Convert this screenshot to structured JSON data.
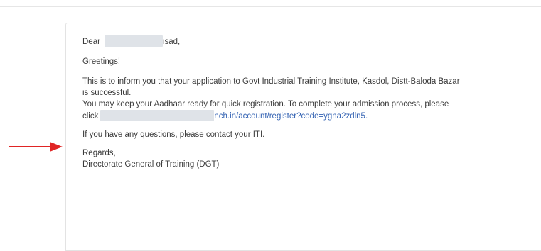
{
  "email": {
    "greeting_prefix": "Dear",
    "greeting_suffix": "isad,",
    "salutation": "Greetings!",
    "para1_line1": "This is to inform you that your application to Govt Industrial Training Institute, Kasdol, Distt-Baloda Bazar",
    "para1_line2": "is successful.",
    "para2_line1": "You may keep your Aadhaar ready for quick registration. To complete your admission process, please",
    "para2_prefix": "click",
    "link_visible": "nch.in/account/register?code=ygna2zdln5",
    "link_end": ".",
    "questions": "If you have any questions, please contact your ITI.",
    "closing": "Regards,",
    "signature": "Directorate General of Training (DGT)"
  },
  "annotation": {
    "arrow_color": "#e02424",
    "arrow_icon": "arrow-right-icon"
  }
}
